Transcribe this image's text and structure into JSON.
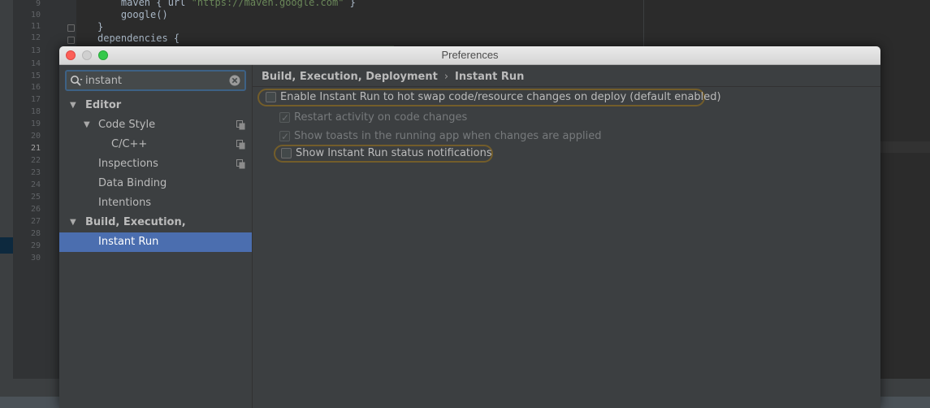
{
  "editor": {
    "line_numbers": [
      "9",
      "10",
      "11",
      "12",
      "13",
      "14",
      "15",
      "16",
      "17",
      "18",
      "19",
      "20",
      "21",
      "22",
      "23",
      "24",
      "25",
      "26",
      "27",
      "28",
      "29",
      "30"
    ],
    "current_line": "21",
    "code_lines": [
      {
        "pre": "    maven { url ",
        "str": "\"https://maven.google.com\"",
        "post": " }"
      },
      {
        "pre": "    google()",
        "str": "",
        "post": ""
      },
      {
        "pre": "}",
        "str": "",
        "post": ""
      },
      {
        "pre": "dependencies {",
        "str": "",
        "post": ""
      }
    ]
  },
  "dialog": {
    "title": "Preferences",
    "window_controls": [
      "close",
      "minimize",
      "zoom"
    ]
  },
  "search": {
    "value": "instant",
    "icon": "search-icon",
    "clear_icon": "clear-icon"
  },
  "tree": [
    {
      "label": "Editor",
      "expanded": true,
      "bold": true,
      "level": 0,
      "arrow": "▼"
    },
    {
      "label": "Code Style",
      "expanded": true,
      "bold": false,
      "level": 1,
      "arrow": "▼",
      "copy_icon": true
    },
    {
      "label": "C/C++",
      "bold": false,
      "level": 2,
      "copy_icon": true
    },
    {
      "label": "Inspections",
      "bold": false,
      "level": 1,
      "copy_icon": true
    },
    {
      "label": "Data Binding",
      "bold": false,
      "level": 1
    },
    {
      "label": "Intentions",
      "bold": false,
      "level": 1
    },
    {
      "label": "Build, Execution, Deployment",
      "expanded": true,
      "bold": true,
      "level": 0,
      "arrow": "▼"
    },
    {
      "label": "Instant Run",
      "bold": false,
      "level": 1,
      "selected": true
    }
  ],
  "breadcrumb": {
    "parent": "Build, Execution, Deployment",
    "separator": "›",
    "current": "Instant Run"
  },
  "options": [
    {
      "label": "Enable Instant Run to hot swap code/resource changes on deploy (default enabled)",
      "checked": false,
      "enabled": true,
      "highlighted": true
    },
    {
      "label": "Restart activity on code changes",
      "checked": true,
      "enabled": false,
      "highlighted": false
    },
    {
      "label": "Show toasts in the running app when changes are applied",
      "checked": true,
      "enabled": false,
      "highlighted": false
    },
    {
      "label": "Show Instant Run status notifications",
      "checked": false,
      "enabled": true,
      "highlighted": true
    }
  ],
  "colors": {
    "selection": "#4b6eaf",
    "search_highlight": "#735d2a",
    "panel_bg": "#3c3f41",
    "editor_bg": "#2b2b2b"
  }
}
